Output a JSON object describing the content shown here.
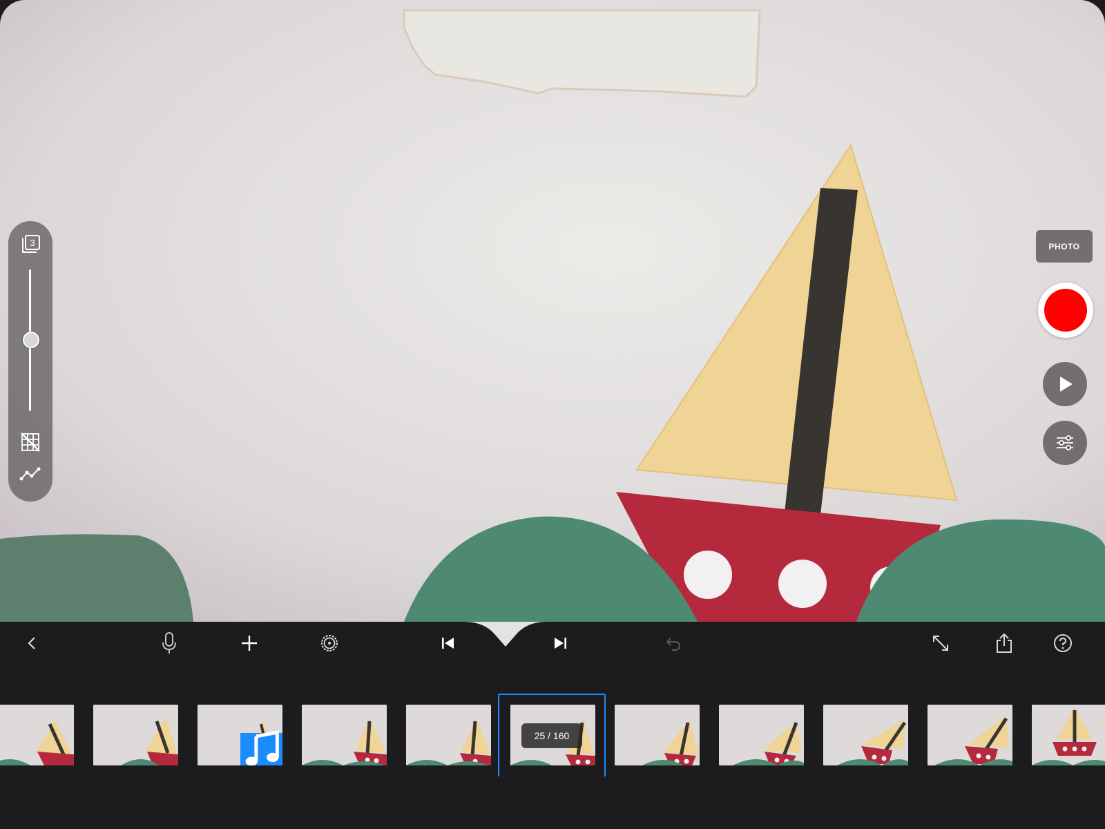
{
  "viewport": {
    "scene_description_icon": "paper-sailboat-scene"
  },
  "left_panel": {
    "onion_skin_count": "3",
    "icons": [
      "onion-skin-icon",
      "grid-off-icon",
      "graph-icon"
    ],
    "onion_opacity_level": 0.5
  },
  "right_panel": {
    "photo_label": "PHOTO",
    "icons": [
      "record-icon",
      "play-icon",
      "sliders-icon"
    ]
  },
  "toolbar": {
    "icons": [
      "back-icon",
      "microphone-icon",
      "plus-icon",
      "settings-icon",
      "skip-to-start-icon",
      "skip-to-end-icon",
      "undo-icon",
      "expand-icon",
      "share-icon",
      "help-icon"
    ],
    "undo_enabled": false
  },
  "filmstrip": {
    "frame_counter": "25 / 160",
    "current_frame": 25,
    "total_frames": 160,
    "audio_marker_icon": "music-note-icon"
  },
  "colors": {
    "accent": "#1a8cff",
    "record": "#ff0000",
    "toolbar_bg": "#1c1c1e"
  }
}
